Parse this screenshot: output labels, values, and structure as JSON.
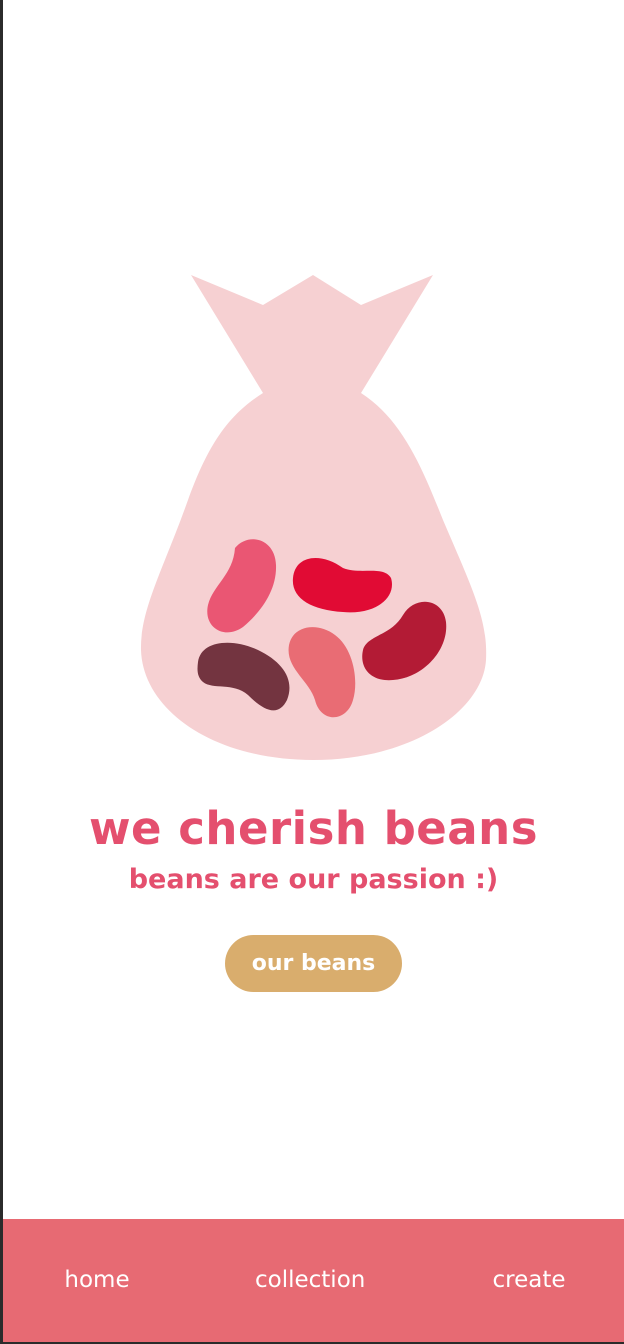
{
  "hero": {
    "title": "we cherish beans",
    "subtitle": "beans are our passion :)",
    "cta_label": "our beans"
  },
  "nav": {
    "items": [
      {
        "label": "home"
      },
      {
        "label": "collection"
      },
      {
        "label": "create"
      }
    ]
  },
  "colors": {
    "accent": "#e44f6e",
    "button": "#d9ad6d",
    "nav_bar": "#e76a73",
    "bag": "#f6d0d2"
  },
  "illustration": {
    "icon": "bean-bag-icon"
  }
}
